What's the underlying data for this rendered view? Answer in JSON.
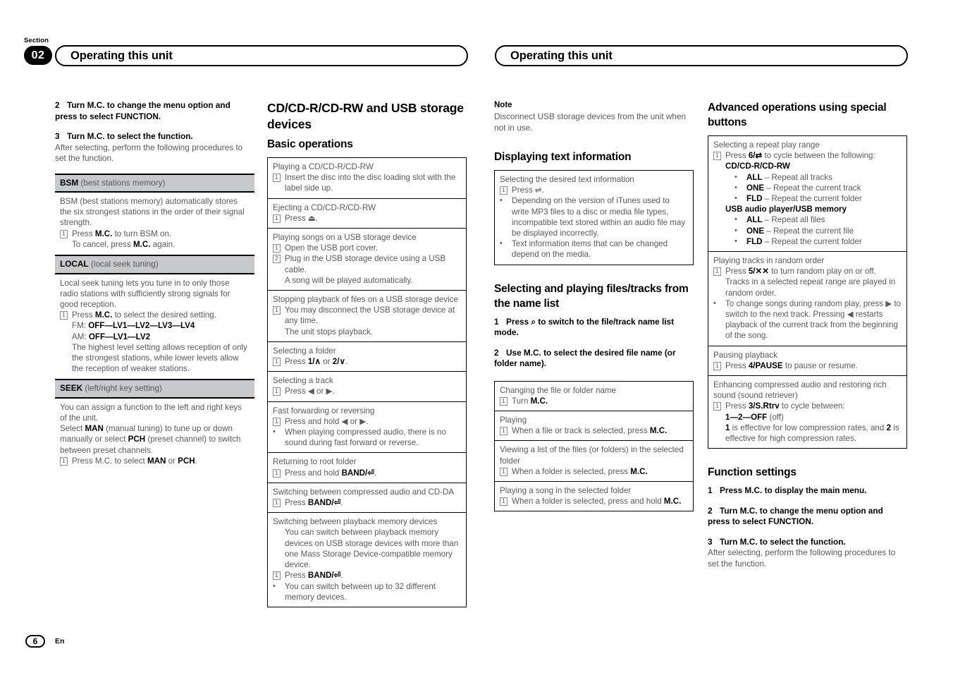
{
  "section": {
    "label": "Section",
    "number": "02"
  },
  "running_head": {
    "left": "Operating this unit",
    "right": "Operating this unit"
  },
  "footer": {
    "page": "6",
    "language": "En"
  },
  "colors": {
    "band_gray": "#c8c9ca",
    "body_gray": "#58595b",
    "ink": "#000000"
  },
  "col1": {
    "step2_num": "2",
    "step2_text": "Turn M.C. to change the menu option and press to select FUNCTION.",
    "step3_num": "3",
    "step3_text": "Turn M.C. to select the function.",
    "step3_body": "After selecting, perform the following procedures to set the function.",
    "bsm": {
      "code": "BSM",
      "name": "(best stations memory)",
      "intro": "BSM (best stations memory) automatically stores the six strongest stations in the order of their signal strength.",
      "step_num": "1",
      "step_pre": "Press ",
      "step_bold": "M.C.",
      "step_post": " to turn BSM on.",
      "step_sub_pre": "To cancel, press ",
      "step_sub_bold": "M.C.",
      "step_sub_post": " again."
    },
    "local": {
      "code": "LOCAL",
      "name": "(local seek tuning)",
      "intro": "Local seek tuning lets you tune in to only those radio stations with sufficiently strong signals for good reception.",
      "step_num": "1",
      "step_pre": "Press ",
      "step_bold": "M.C.",
      "step_post": " to select the desired setting.",
      "fm_label": "FM: ",
      "fm_values": "OFF—LV1—LV2—LV3—LV4",
      "am_label": "AM: ",
      "am_values": "OFF—LV1—LV2",
      "note": "The highest level setting allows reception of only the strongest stations, while lower levels allow the reception of weaker stations."
    },
    "seek": {
      "code": "SEEK",
      "name": "(left/right key setting)",
      "intro": "You can assign a function to the left and right keys of the unit.",
      "select_pre": "Select ",
      "select_b1": "MAN",
      "select_mid": " (manual tuning) to tune up or down manually or select ",
      "select_b2": "PCH",
      "select_post": " (preset channel) to switch between preset channels.",
      "step_num": "1",
      "step_pre": "Press M.C. to select ",
      "step_b1": "MAN",
      "step_mid": " or ",
      "step_b2": "PCH",
      "step_post": "."
    }
  },
  "col2": {
    "title": "CD/CD-R/CD-RW and USB storage devices",
    "subtitle": "Basic operations",
    "rows": [
      {
        "title": "Playing a CD/CD-R/CD-RW",
        "lines": [
          {
            "mark": "1",
            "text": "Insert the disc into the disc loading slot with the label side up."
          }
        ],
        "thin": true
      },
      {
        "title": "Ejecting a CD/CD-R/CD-RW",
        "lines": [
          {
            "mark": "1",
            "text": "Press ⏏."
          }
        ],
        "thin": false
      },
      {
        "title": "Playing songs on a USB storage device",
        "lines": [
          {
            "mark": "1",
            "text": "Open the USB port cover."
          },
          {
            "mark": "2",
            "text": "Plug in the USB storage device using a USB cable."
          },
          {
            "mark": "",
            "text": "A song will be played automatically."
          }
        ],
        "thin": true
      },
      {
        "title": "Stopping playback of files on a USB storage device",
        "lines": [
          {
            "mark": "1",
            "text": "You may disconnect the USB storage device at any time."
          },
          {
            "mark": "",
            "text": "The unit stops playback."
          }
        ],
        "thin": false
      },
      {
        "title": "Selecting a folder",
        "lines": [
          {
            "mark": "1",
            "text": "Press 1/∧ or 2/∨."
          }
        ],
        "thin": false
      },
      {
        "title": "Selecting a track",
        "lines": [
          {
            "mark": "1",
            "text": "Press ◀ or ▶."
          }
        ],
        "thin": false
      },
      {
        "title": "Fast forwarding or reversing",
        "lines": [
          {
            "mark": "1",
            "text": "Press and hold ◀ or ▶."
          },
          {
            "mark": "•",
            "text": "When playing compressed audio, there is no sound during fast forward or reverse."
          }
        ],
        "thin": false
      },
      {
        "title": "Returning to root folder",
        "lines": [
          {
            "mark": "1",
            "text": "Press and hold BAND/⏎."
          }
        ],
        "thin": false
      },
      {
        "title": "Switching between compressed audio and CD-DA",
        "lines": [
          {
            "mark": "1",
            "text": "Press BAND/⏎."
          }
        ],
        "thin": false
      },
      {
        "title": "Switching between playback memory devices",
        "lines": [
          {
            "mark": "",
            "text": "You can switch between playback memory devices on USB storage devices with more than one Mass Storage Device-compatible memory device."
          },
          {
            "mark": "1",
            "text": "Press BAND/⏎."
          },
          {
            "mark": "•",
            "text": "You can switch between up to 32 different memory devices."
          }
        ],
        "thin": false
      }
    ]
  },
  "col3": {
    "note_heading": "Note",
    "note_text": "Disconnect USB storage devices from the unit when not in use.",
    "h_display": "Displaying text information",
    "text_info_row": {
      "title": "Selecting the desired text information",
      "step_num": "1",
      "step_text": "Press ⇌.",
      "bullets": [
        "Depending on the version of iTunes used to write MP3 files to a disc or media file types, incompatible text stored within an audio file may be displayed incorrectly.",
        "Text information items that can be changed depend on the media."
      ]
    },
    "h_selecting": "Selecting and playing files/tracks from the name list",
    "step1_num": "1",
    "step1_text": "Press ⌕ to switch to the file/track name list mode.",
    "step2_num": "2",
    "step2_text": "Use M.C. to select the desired file name (or folder name).",
    "rows": [
      {
        "title": "Changing the file or folder name",
        "lines": [
          {
            "mark": "1",
            "text": "Turn M.C."
          }
        ],
        "thin": true
      },
      {
        "title": "Playing",
        "lines": [
          {
            "mark": "1",
            "text": "When a file or track is selected, press M.C."
          }
        ],
        "thin": false
      },
      {
        "title": "Viewing a list of the files (or folders) in the selected folder",
        "lines": [
          {
            "mark": "1",
            "text": "When a folder is selected, press M.C."
          }
        ],
        "thin": false
      },
      {
        "title": "Playing a song in the selected folder",
        "lines": [
          {
            "mark": "1",
            "text": "When a folder is selected, press and hold M.C."
          }
        ],
        "thin": false
      }
    ]
  },
  "col4": {
    "h_advanced": "Advanced operations using special buttons",
    "repeat_row": {
      "title": "Selecting a repeat play range",
      "step_num": "1",
      "step_pre": "Press ",
      "step_key": "6/⇄",
      "step_post": " to cycle between the following:",
      "group1_label": "CD/CD-R/CD-RW",
      "group1_items": [
        {
          "code": "ALL",
          "desc": " – Repeat all tracks"
        },
        {
          "code": "ONE",
          "desc": " – Repeat the current track"
        },
        {
          "code": "FLD",
          "desc": " – Repeat the current folder"
        }
      ],
      "group2_label": "USB audio player/USB memory",
      "group2_items": [
        {
          "code": "ALL",
          "desc": " – Repeat all files"
        },
        {
          "code": "ONE",
          "desc": " – Repeat the current file"
        },
        {
          "code": "FLD",
          "desc": " – Repeat the current folder"
        }
      ]
    },
    "random_row": {
      "title": "Playing tracks in random order",
      "step_num": "1",
      "step_pre": "Press ",
      "step_key": "5/✕✕",
      "step_post": " to turn random play on or off.",
      "step_sub": "Tracks in a selected repeat range are played in random order.",
      "bullet": "To change songs during random play, press ▶ to switch to the next track. Pressing ◀ restarts playback of the current track from the beginning of the song."
    },
    "pause_row": {
      "title": "Pausing playback",
      "step_num": "1",
      "step_pre": "Press ",
      "step_key": "4/PAUSE",
      "step_post": " to pause or resume."
    },
    "retriever_row": {
      "title": "Enhancing compressed audio and restoring rich sound (sound retriever)",
      "step_num": "1",
      "step_pre": "Press ",
      "step_key": "3/S.Rtrv",
      "step_post": " to cycle between:",
      "values_bold": "1—2—OFF",
      "values_post": " (off)",
      "note_a": "1",
      "note_b": " is effective for low compression rates, and ",
      "note_c": "2",
      "note_d": " is effective for high compression rates."
    },
    "h_function": "Function settings",
    "step1_num": "1",
    "step1_text": "Press M.C. to display the main menu.",
    "step2_num": "2",
    "step2_text": "Turn M.C. to change the menu option and press to select FUNCTION.",
    "step3_num": "3",
    "step3_text": "Turn M.C. to select the function.",
    "step3_body": "After selecting, perform the following procedures to set the function."
  }
}
